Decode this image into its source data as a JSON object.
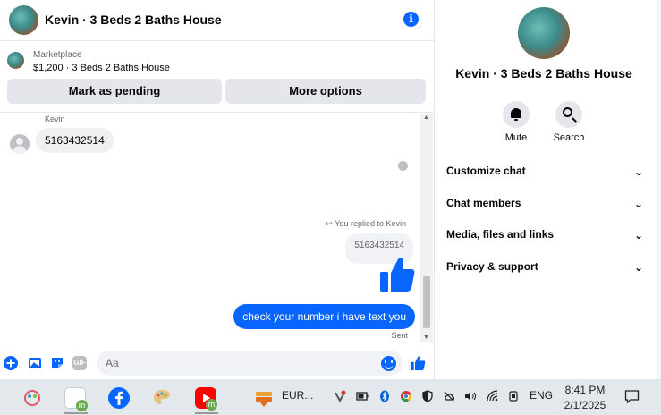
{
  "header": {
    "title": "Kevin · 3 Beds 2 Baths House",
    "info_icon": "i"
  },
  "listing": {
    "category": "Marketplace",
    "item": "$1,200 · 3 Beds 2 Baths House",
    "mark_pending_label": "Mark as pending",
    "more_options_label": "More options"
  },
  "messages": {
    "sender_name": "Kevin",
    "incoming_text": "5163432514",
    "replied_label": "You replied to Kevin",
    "quoted_text": "5163432514",
    "outgoing_text": "check your number i have text you",
    "status": "Sent"
  },
  "composer": {
    "placeholder": "Aa",
    "gif_label": "GIF"
  },
  "panel": {
    "title": "Kevin · 3 Beds 2 Baths House",
    "mute_label": "Mute",
    "search_label": "Search",
    "sections": [
      "Customize chat",
      "Chat members",
      "Media, files and links",
      "Privacy & support"
    ]
  },
  "taskbar": {
    "app_label": "EUR...",
    "language": "ENG",
    "time": "8:41 PM",
    "date": "2/1/2025",
    "badge_letter": "m"
  },
  "colors": {
    "accent": "#0866ff",
    "bubble_in": "#f0f0f0",
    "button_bg": "#e4e6eb",
    "taskbar_bg": "#e2e8ec"
  }
}
